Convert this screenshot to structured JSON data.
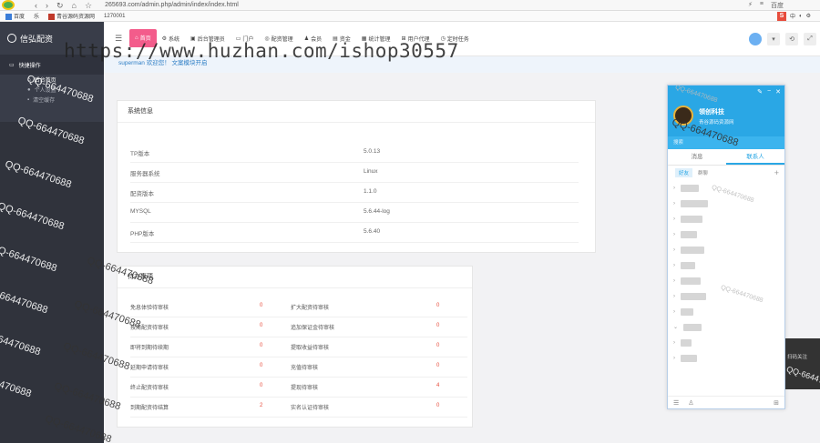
{
  "browser": {
    "url": "265693.com/admin.php/admin/index/index.html",
    "tab_right_label": "百度"
  },
  "bookmarks": [
    "百度",
    "乐",
    "青谷源码资源网",
    "1270001"
  ],
  "sidebar": {
    "brand": "信弘配资",
    "group_label": "快捷操作",
    "items": [
      {
        "label": "后台首页",
        "active": true
      },
      {
        "label": "个人设置",
        "active": false
      },
      {
        "label": "清空缓存",
        "active": false
      }
    ]
  },
  "topnav": {
    "tabs": [
      {
        "label": "首页",
        "active": true
      },
      {
        "label": "系统",
        "active": false
      },
      {
        "label": "后台管理员",
        "active": false
      },
      {
        "label": "门户",
        "active": false
      },
      {
        "label": "配资管理",
        "active": false
      },
      {
        "label": "会员",
        "active": false
      },
      {
        "label": "资金",
        "active": false
      },
      {
        "label": "统计管理",
        "active": false
      },
      {
        "label": "用户代理",
        "active": false
      },
      {
        "label": "定时任务",
        "active": false
      }
    ]
  },
  "welcome": "superman 欢迎您！ 文案模块开启",
  "system_info": {
    "title": "系统信息",
    "rows": [
      {
        "key": "TP版本",
        "value": "5.0.13"
      },
      {
        "key": "服务器系统",
        "value": "Linux"
      },
      {
        "key": "配资版本",
        "value": "1.1.0"
      },
      {
        "key": "MYSQL",
        "value": "5.6.44-log"
      },
      {
        "key": "PHP版本",
        "value": "5.6.40"
      }
    ]
  },
  "todo": {
    "title": "待办事项",
    "rows": [
      [
        {
          "label": "免息体验待审核",
          "count": "0"
        },
        {
          "label": "扩大配资待审核",
          "count": "0"
        }
      ],
      [
        {
          "label": "按周配资待审核",
          "count": "0"
        },
        {
          "label": "追加保证金待审核",
          "count": "0"
        }
      ],
      [
        {
          "label": "即将到期待续期",
          "count": "0"
        },
        {
          "label": "提取收益待审核",
          "count": "0"
        }
      ],
      [
        {
          "label": "延期申请待审核",
          "count": "0"
        },
        {
          "label": "充值待审核",
          "count": "0"
        }
      ],
      [
        {
          "label": "终止配资待审核",
          "count": "0"
        },
        {
          "label": "提现待审核",
          "count": "4"
        }
      ],
      [
        {
          "label": "到期配资待结算",
          "count": "2"
        },
        {
          "label": "实名认证待审核",
          "count": "0"
        }
      ]
    ]
  },
  "qq": {
    "name": "领创科技",
    "signature": "青谷源码资源网",
    "search": "搜索",
    "tabs": [
      "消息",
      "联系人"
    ],
    "subtabs": [
      "好友",
      "群聊"
    ],
    "contacts": [
      "",
      "",
      "",
      "",
      "",
      "",
      "",
      "",
      "",
      "",
      "",
      ""
    ]
  },
  "side_tip": "扫码关注",
  "watermarks": {
    "big": "https://www.huzhan.com/ishop30557",
    "qq": "QQ-664470688"
  }
}
